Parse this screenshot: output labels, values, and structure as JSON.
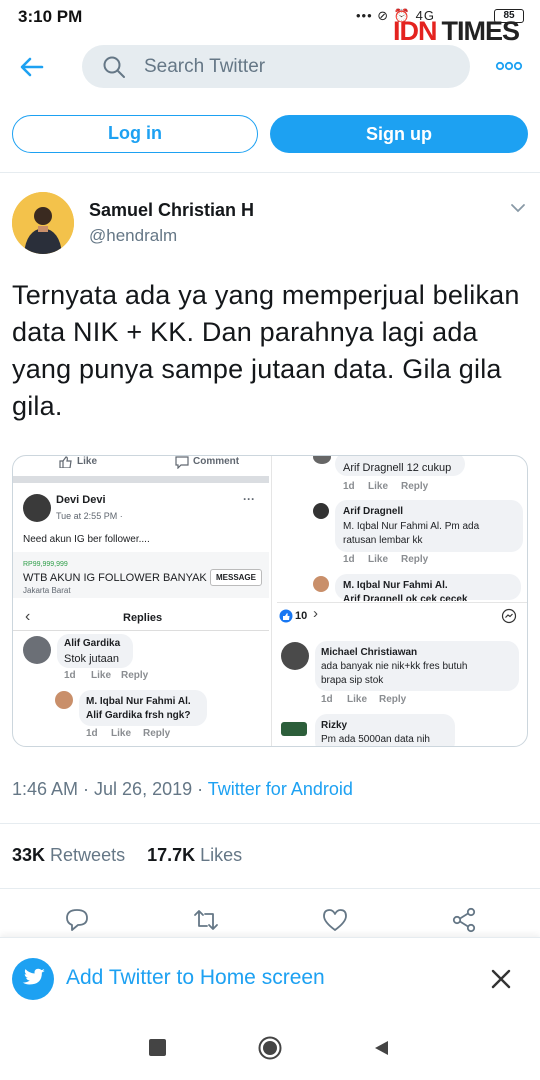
{
  "status_bar": {
    "time": "3:10 PM",
    "network": "4G",
    "battery": "85"
  },
  "watermark": {
    "part1": "IDN",
    "part2": "TIMES"
  },
  "topbar": {
    "search_placeholder": "Search Twitter"
  },
  "auth": {
    "login_label": "Log in",
    "signup_label": "Sign up"
  },
  "tweet": {
    "display_name": "Samuel Christian H",
    "handle": "@hendralm",
    "text": "Ternyata ada ya yang memperjual belikan data NIK + KK. Dan parahnya lagi ada yang punya sampe jutaan data. Gila gila gila.",
    "timestamp": "1:46 AM · Jul 26, 2019 · ",
    "client": "Twitter for Android",
    "retweets_count": "33K",
    "retweets_label": "Retweets",
    "likes_count": "17.7K",
    "likes_label": "Likes"
  },
  "media": {
    "like": "Like",
    "comment": "Comment",
    "post_author": "Devi Devi",
    "post_time": "Tue at 2:55 PM ·",
    "post_text": "Need akun IG ber follower....",
    "price": "RP99,999,999",
    "listing_title": "WTB AKUN IG FOLLOWER BANYAK",
    "message_btn": "MESSAGE",
    "location": "Jakarta Barat",
    "replies_title": "Replies",
    "reaction_count": "10",
    "reply_meta": {
      "time": "1d",
      "like": "Like",
      "reply": "Reply"
    },
    "left_comments": [
      {
        "name": "Alif Gardika",
        "text": "Stok jutaan"
      },
      {
        "name": "M. Iqbal Nur Fahmi Al.",
        "text": "Alif Gardika frsh ngk?"
      }
    ],
    "right_comments": [
      {
        "text": "Arif Dragnell 12 cukup"
      },
      {
        "name": "Arif Dragnell",
        "text1": "M. Iqbal Nur Fahmi Al. Pm ada",
        "text2": "ratusan lembar kk"
      },
      {
        "name": "M. Iqbal Nur Fahmi Al.",
        "text": "Arif Dragnell ok cek cecek"
      },
      {
        "name": "Michael Christiawan",
        "text1": "ada banyak nie nik+kk fres butuh",
        "text2": "brapa sip stok"
      },
      {
        "name": "Rizky",
        "text": "Pm ada 5000an data nih"
      }
    ]
  },
  "banner": {
    "text": "Add Twitter to Home screen"
  },
  "colors": {
    "brand": "#1da1f2",
    "text": "#14171a",
    "muted": "#657786"
  }
}
